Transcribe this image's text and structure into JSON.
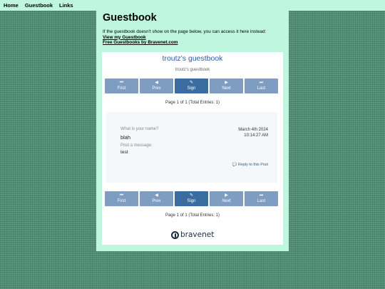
{
  "nav": {
    "items": [
      "Home",
      "Guestbook",
      "Links"
    ]
  },
  "page": {
    "title": "Guestbook",
    "intro": "If the guestbook doesn't show on the page below, you can access it here instead:",
    "link_view": "View my Guestbook",
    "link_free": "Free Guestbooks by Bravenet.com"
  },
  "guestbook": {
    "title": "troutz's guestbook",
    "subtitle": "troutz's guestbook",
    "buttons": [
      {
        "icon": "first-icon",
        "glyph": "⏮",
        "label": "First"
      },
      {
        "icon": "prev-icon",
        "glyph": "◀",
        "label": "Prev"
      },
      {
        "icon": "pencil-icon",
        "glyph": "✎",
        "label": "Sign"
      },
      {
        "icon": "next-icon",
        "glyph": "▶",
        "label": "Next"
      },
      {
        "icon": "last-icon",
        "glyph": "⏭",
        "label": "Last"
      }
    ],
    "page_info": "Page 1 of 1 (Total Entries: 1)",
    "entry": {
      "q1": "What is your name?",
      "a1": "blah",
      "q2": "Post a message:",
      "a2": "test",
      "date": "March 4th 2024",
      "time": "10:14:27 AM",
      "reply": "Reply to this Post",
      "reply_glyph": "💬"
    },
    "brand": "bravenet"
  },
  "colors": {
    "background": "#4f8d76",
    "panel": "#bff6e0",
    "button": "#7f9dc0",
    "button_active": "#3b6ca0",
    "link_blue": "#2f5f94"
  }
}
